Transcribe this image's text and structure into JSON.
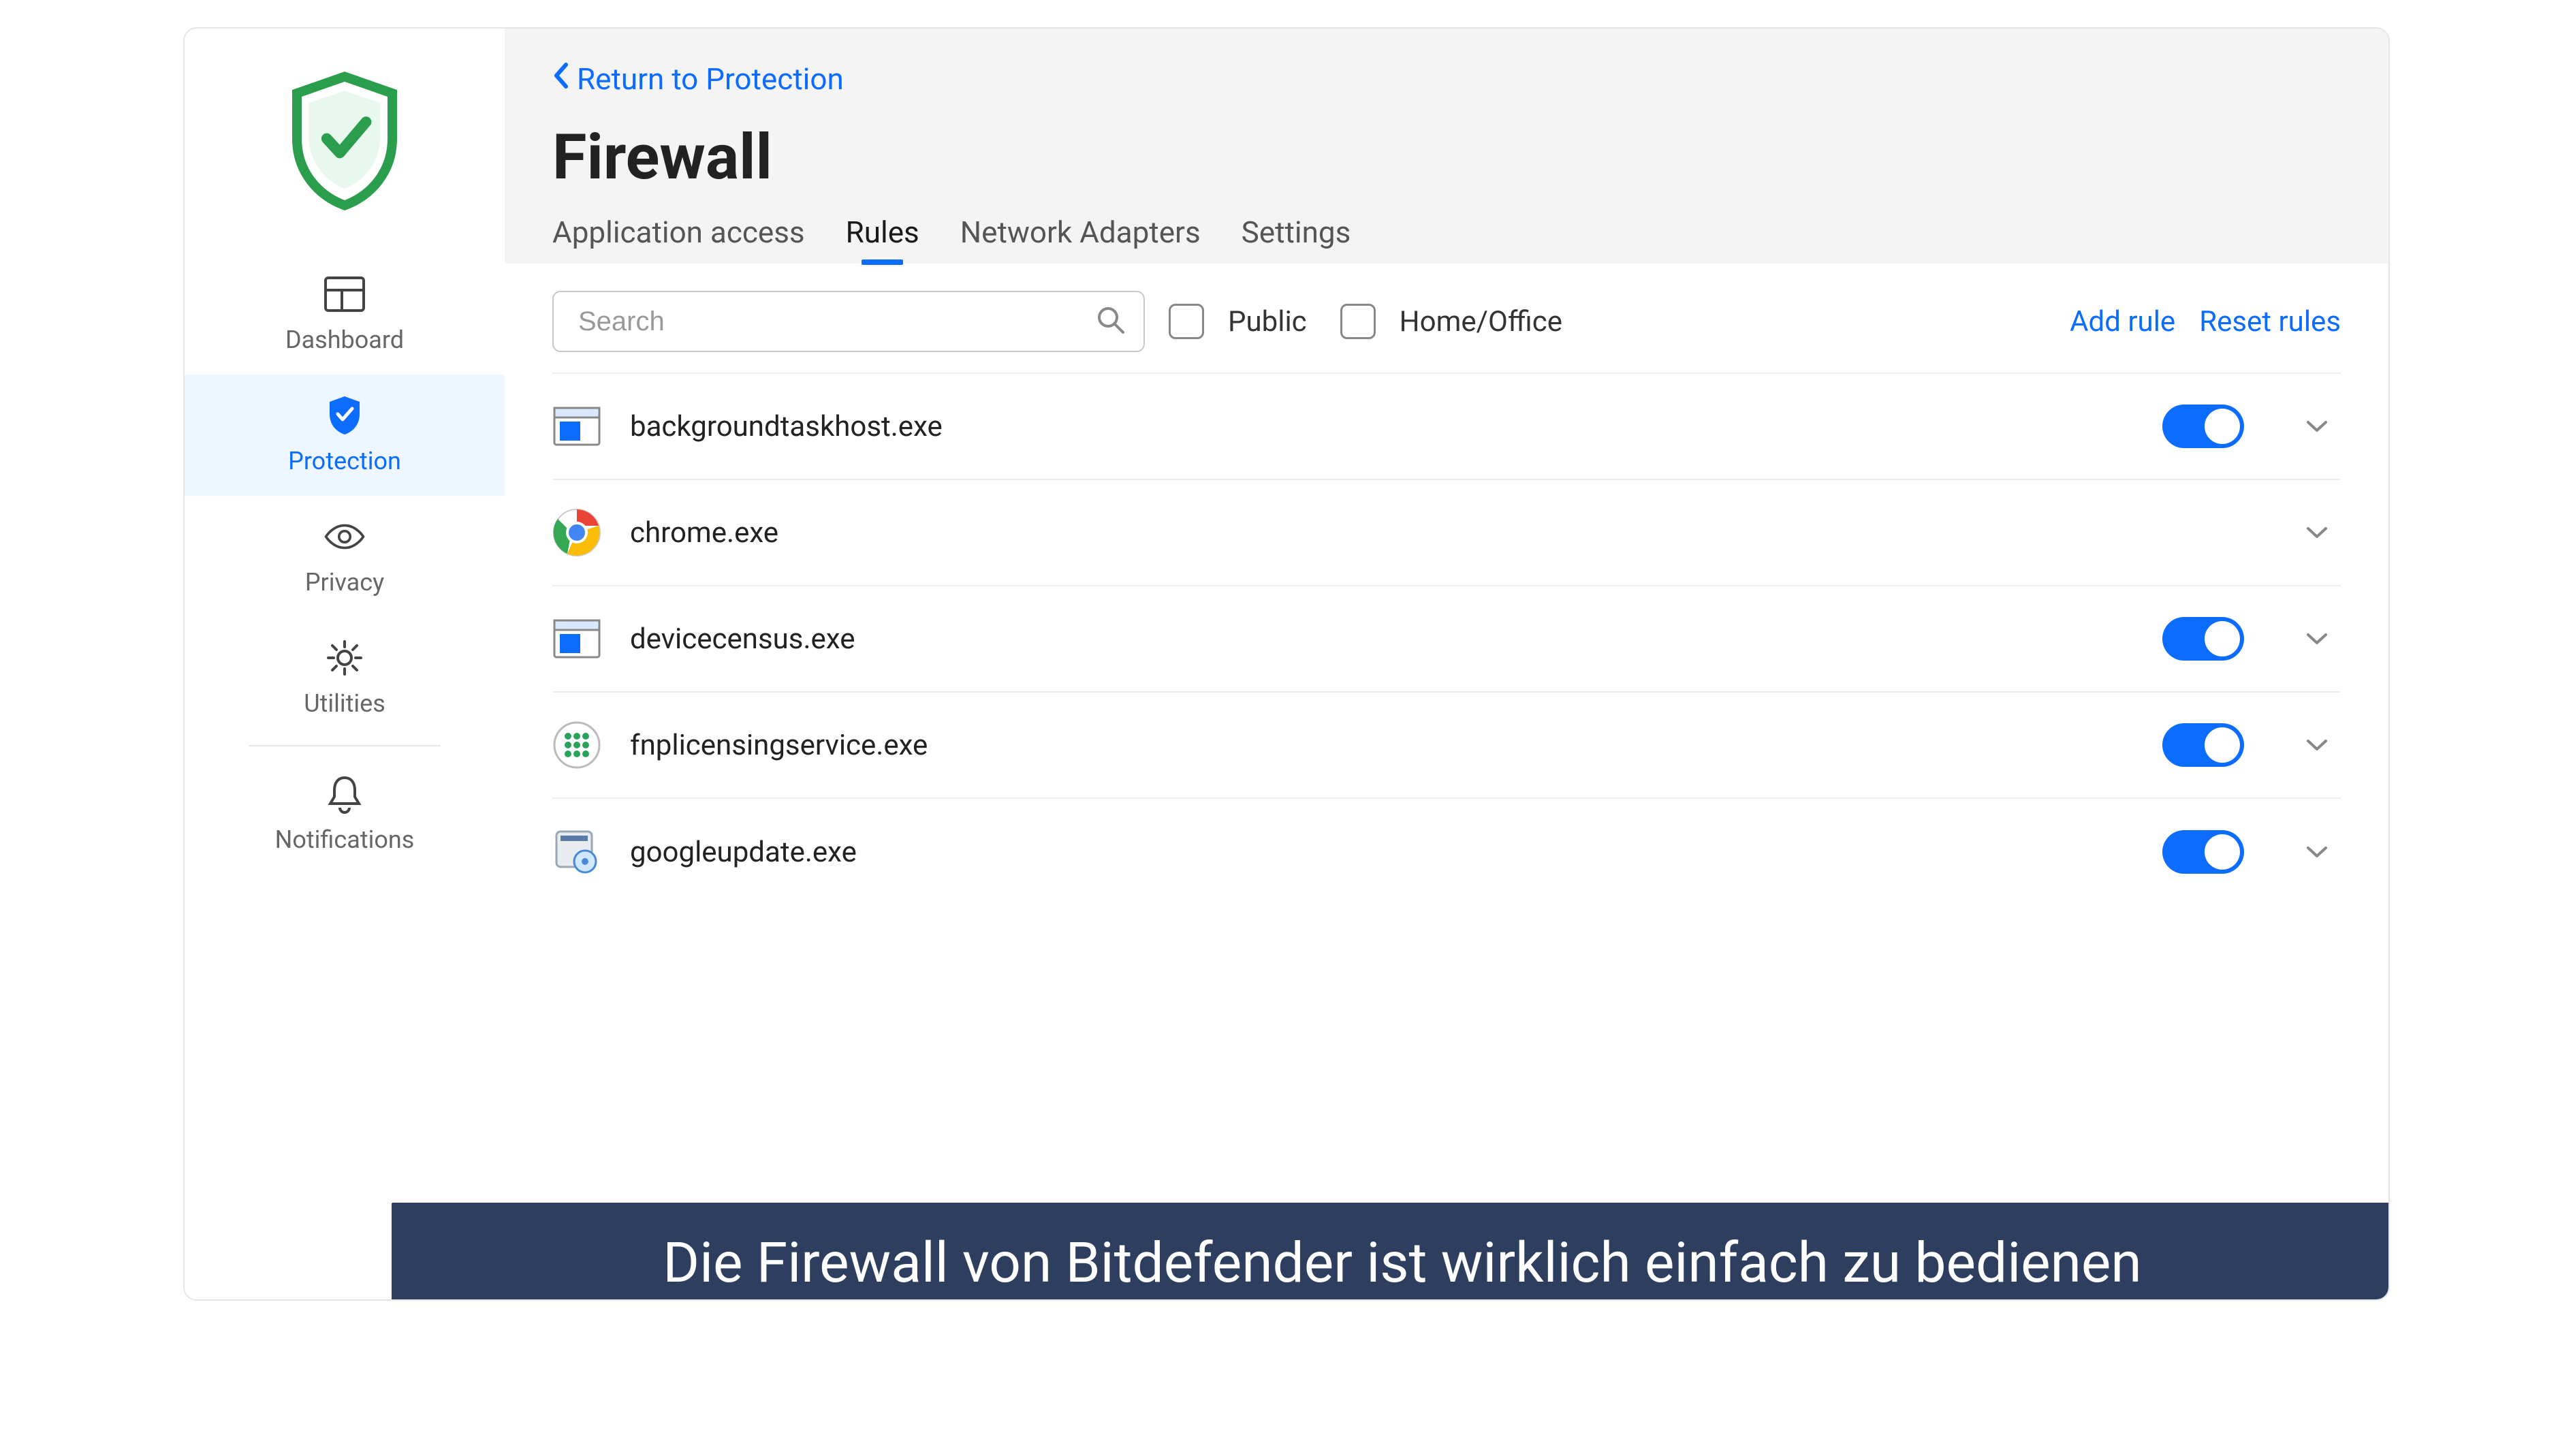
{
  "sidebar": {
    "items": [
      {
        "label": "Dashboard",
        "active": false
      },
      {
        "label": "Protection",
        "active": true
      },
      {
        "label": "Privacy",
        "active": false
      },
      {
        "label": "Utilities",
        "active": false
      },
      {
        "label": "Notifications",
        "active": false
      }
    ]
  },
  "header": {
    "back_label": "Return to Protection",
    "title": "Firewall",
    "tabs": [
      {
        "label": "Application access",
        "active": false
      },
      {
        "label": "Rules",
        "active": true
      },
      {
        "label": "Network Adapters",
        "active": false
      },
      {
        "label": "Settings",
        "active": false
      }
    ]
  },
  "toolbar": {
    "search_placeholder": "Search",
    "filters": [
      {
        "label": "Public",
        "checked": false
      },
      {
        "label": "Home/Office",
        "checked": false
      }
    ],
    "add_rule_label": "Add rule",
    "reset_rules_label": "Reset rules"
  },
  "rules": [
    {
      "name": "backgroundtaskhost.exe",
      "icon": "window",
      "toggle": true,
      "show_toggle": true
    },
    {
      "name": "chrome.exe",
      "icon": "chrome",
      "toggle": false,
      "show_toggle": false
    },
    {
      "name": "devicecensus.exe",
      "icon": "window",
      "toggle": true,
      "show_toggle": true
    },
    {
      "name": "fnplicensingservice.exe",
      "icon": "dots",
      "toggle": true,
      "show_toggle": true
    },
    {
      "name": "googleupdate.exe",
      "icon": "installer",
      "toggle": true,
      "show_toggle": true
    }
  ],
  "caption": "Die Firewall von Bitdefender ist wirklich einfach zu bedienen",
  "colors": {
    "accent": "#0b6cff",
    "sidebar_active_bg": "#eef6ff",
    "banner_bg": "#2d3e5e",
    "logo_green": "#2b9e4d"
  }
}
